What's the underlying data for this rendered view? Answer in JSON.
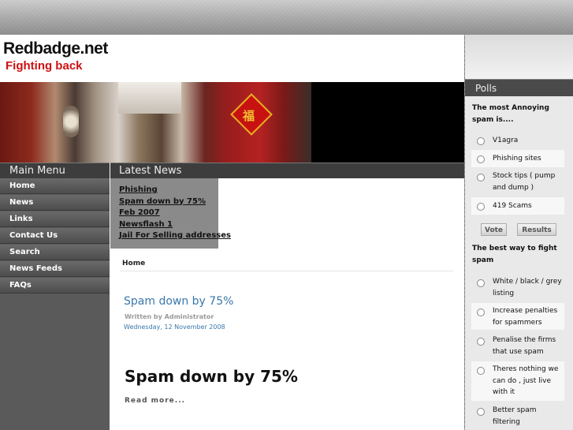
{
  "header": {
    "logo": "Redbadge.net",
    "tagline": "Fighting back"
  },
  "banner": {
    "poster_char": "福"
  },
  "bars": {
    "main_menu": "Main Menu",
    "latest_news": "Latest News",
    "polls": "Polls"
  },
  "menu": [
    "Home",
    "News",
    "Links",
    "Contact Us",
    "Search",
    "News Feeds",
    "FAQs"
  ],
  "latest_news": [
    "Phishing",
    "Spam down by 75%",
    "Feb 2007",
    "Newsflash 1",
    "Jail For Selling addresses"
  ],
  "content": {
    "breadcrumb": "Home",
    "article_title": "Spam down by 75%",
    "author": "Written by Administrator",
    "date": "Wednesday, 12 November 2008",
    "heading": "Spam down by 75%",
    "read_more": "Read more..."
  },
  "polls": {
    "q1": "The most Annoying spam is....",
    "q1_options": [
      "V1agra",
      "Phishing sites",
      "Stock tips ( pump and dump )",
      "419 Scams"
    ],
    "vote": "Vote",
    "results": "Results",
    "q2": "The best way to fight spam",
    "q2_options": [
      "White / black / grey listing",
      "Increase penalties for spammers",
      "Penalise the firms that use spam",
      "Theres nothing we can do , just live with it",
      "Better spam filtering"
    ]
  },
  "colors": {
    "accent_red": "#cc1111",
    "link_blue": "#3a77aa",
    "bar_dark": "#3d3d3d"
  }
}
